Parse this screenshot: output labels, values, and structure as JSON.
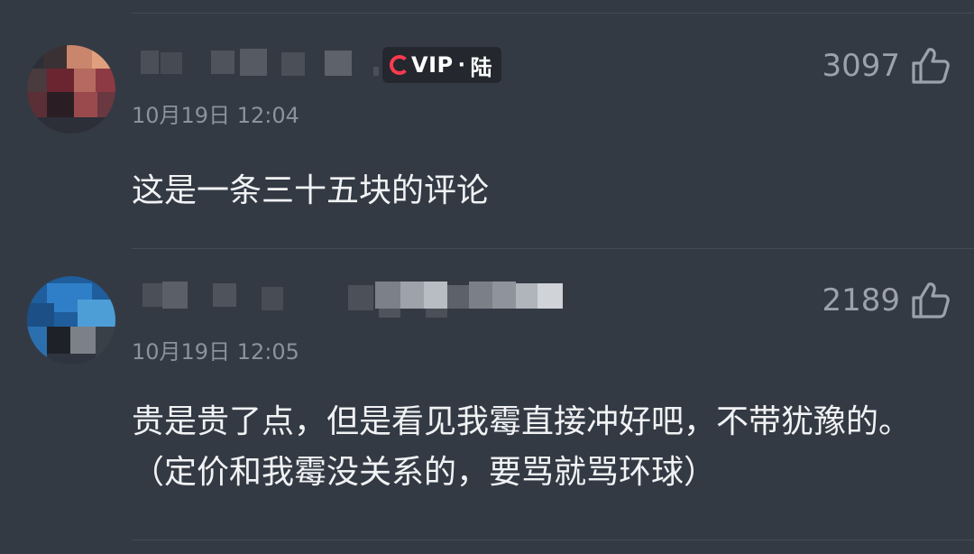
{
  "comments": [
    {
      "vip_badge": {
        "brand": "VIP",
        "dot": "·",
        "name": "陆"
      },
      "timestamp": "10月19日 12:04",
      "likes": "3097",
      "text": "这是一条三十五块的评论"
    },
    {
      "timestamp": "10月19日 12:05",
      "likes": "2189",
      "text": "贵是贵了点，但是看见我霉直接冲好吧，不带犹豫的。（定价和我霉没关系的，要骂就骂环球）"
    }
  ],
  "colors": {
    "background": "#343a44",
    "text": "#f1f2f4",
    "meta": "#8c929c",
    "like": "#9ca2ac",
    "vip_accent": "#ff3a4e"
  },
  "icons": {
    "like": "thumbs-up-icon",
    "vip_logo": "vip-c-logo-icon"
  }
}
